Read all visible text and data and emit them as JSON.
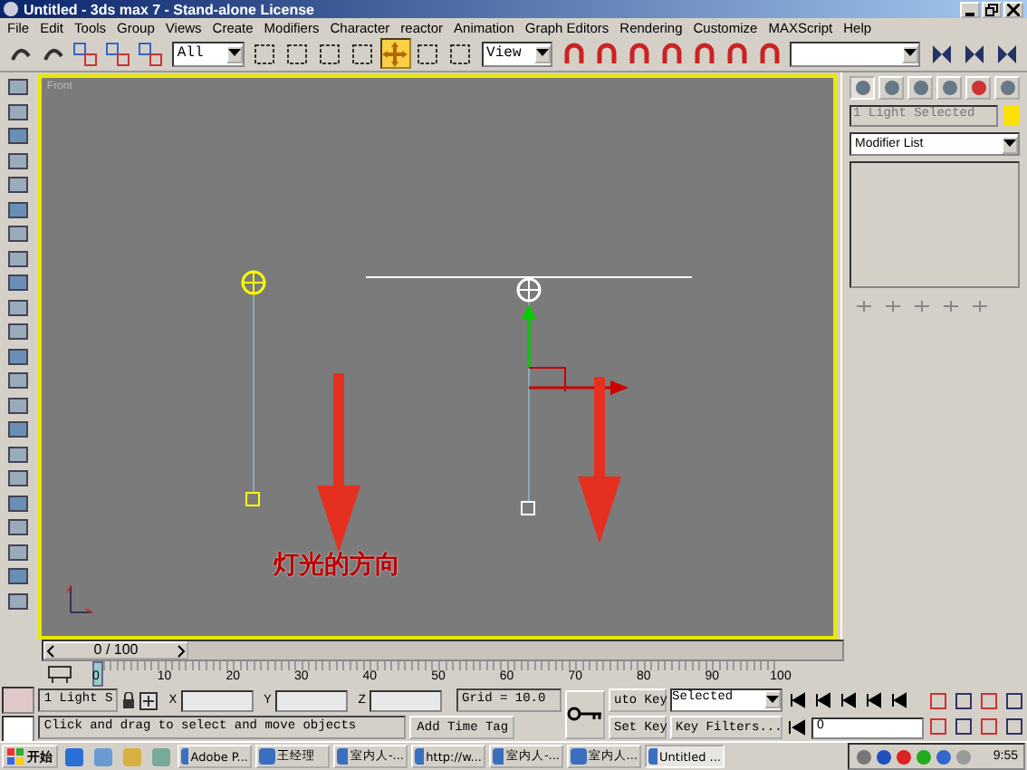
{
  "window": {
    "title": "Untitled - 3ds max 7 - Stand-alone License"
  },
  "menu": [
    "File",
    "Edit",
    "Tools",
    "Group",
    "Views",
    "Create",
    "Modifiers",
    "Character",
    "reactor",
    "Animation",
    "Graph Editors",
    "Rendering",
    "Customize",
    "MAXScript",
    "Help"
  ],
  "toolbar": {
    "tools_left": [
      {
        "selected": false
      },
      {
        "selected": false
      },
      {
        "selected": false
      },
      {
        "selected": false
      },
      {
        "selected": false
      }
    ],
    "selection_filter": "All",
    "tools_mid": [
      {
        "selected": false
      },
      {
        "selected": false
      },
      {
        "selected": false
      },
      {
        "selected": false
      },
      {
        "selected": true
      },
      {
        "selected": false
      },
      {
        "selected": false
      }
    ],
    "reference_coord": "View",
    "tools_right": [
      {
        "selected": false
      },
      {
        "selected": false
      },
      {
        "selected": false
      },
      {
        "selected": false
      },
      {
        "selected": false
      },
      {
        "selected": false
      },
      {
        "selected": false
      }
    ],
    "tools_end": [
      {
        "selected": false
      },
      {
        "selected": false
      },
      {
        "selected": false
      }
    ]
  },
  "viewport": {
    "label": "Front",
    "annotation": "灯光的方向"
  },
  "command_panel": {
    "tabs": [
      {
        "selected": true
      },
      {
        "selected": false
      },
      {
        "selected": false
      },
      {
        "selected": false
      },
      {
        "selected": false
      },
      {
        "selected": false
      }
    ],
    "object_name": "1 Light Selected",
    "modifier_list": "Modifier List"
  },
  "timeline": {
    "position": "0 / 100",
    "ticks": [
      "0",
      "10",
      "20",
      "30",
      "40",
      "50",
      "60",
      "70",
      "80",
      "90",
      "100"
    ]
  },
  "status": {
    "selection": "1 Light S",
    "x_label": "X",
    "y_label": "Y",
    "z_label": "Z",
    "grid": "Grid = 10.0",
    "auto_key": "uto Key",
    "key_mode": "Selected",
    "set_key": "Set Key",
    "key_filters": "Key Filters...",
    "prompt": "Click and drag to select and move objects",
    "add_time_tag": "Add Time Tag",
    "frame": "0"
  },
  "taskbar": {
    "start": "开始",
    "tasks": [
      {
        "label": "Adobe P...",
        "selected": false
      },
      {
        "label": "王经理",
        "selected": false
      },
      {
        "label": "室内人-...",
        "selected": false
      },
      {
        "label": "http://w...",
        "selected": false
      },
      {
        "label": "室内人-...",
        "selected": false
      },
      {
        "label": "室内人...",
        "selected": false
      },
      {
        "label": "Untitled ...",
        "selected": true
      }
    ],
    "clock": "9:55"
  }
}
